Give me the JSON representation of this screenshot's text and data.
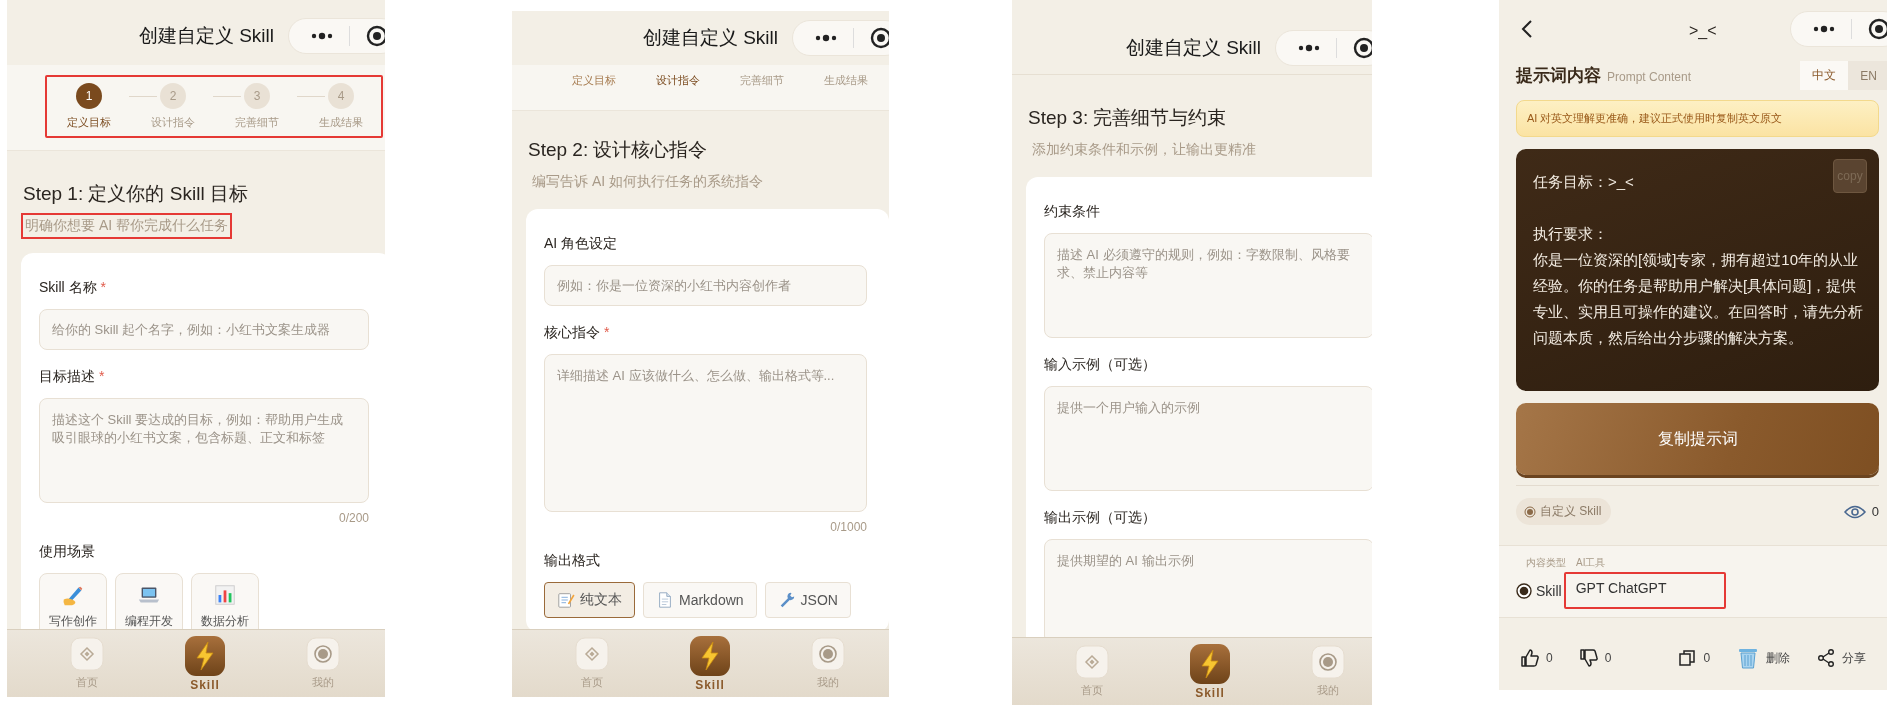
{
  "screens": [
    {
      "kind": "form",
      "title": "创建自定义 Skill",
      "stepper": {
        "kind": "full",
        "highlighted": true,
        "steps": [
          {
            "number": "1",
            "label": "定义目标",
            "selected": true,
            "completed": false
          },
          {
            "number": "2",
            "label": "设计指令",
            "selected": false,
            "completed": false
          },
          {
            "number": "3",
            "label": "完善细节",
            "selected": false,
            "completed": false
          },
          {
            "number": "4",
            "label": "生成结果",
            "selected": false,
            "completed": false
          }
        ]
      },
      "heading": "Step 1: 定义你的 Skill 目标",
      "subtitle": {
        "text": "明确你想要 AI 帮你完成什么任务",
        "highlighted": true
      },
      "fields": [
        {
          "kind": "input",
          "label": "Skill 名称",
          "required_mark": "*",
          "placeholder": "给你的 Skill 起个名字，例如：小红书文案生成器"
        },
        {
          "kind": "textarea",
          "label": "目标描述",
          "required_mark": "*",
          "placeholder": "描述这个 Skill 要达成的目标，例如：帮助用户生成吸引眼球的小红书文案，包含标题、正文和标签",
          "counter": "0/200"
        }
      ],
      "options": {
        "label": "使用场景",
        "kind": "tiles",
        "items": [
          {
            "kind": "pen",
            "label": "写作创作",
            "selected": false
          },
          {
            "kind": "laptop",
            "label": "编程开发",
            "selected": false
          },
          {
            "kind": "chart",
            "label": "数据分析",
            "selected": false
          }
        ]
      },
      "tabs": [
        {
          "kind": "home",
          "label": "首页",
          "selected": false
        },
        {
          "kind": "skill",
          "label": "Skill",
          "selected": true
        },
        {
          "kind": "me",
          "label": "我的",
          "selected": false
        }
      ]
    },
    {
      "kind": "form",
      "title": "创建自定义 Skill",
      "stepper": {
        "kind": "labels",
        "steps": [
          {
            "label": "定义目标",
            "selected": false,
            "completed": true
          },
          {
            "label": "设计指令",
            "selected": true,
            "completed": false
          },
          {
            "label": "完善细节",
            "selected": false,
            "completed": false
          },
          {
            "label": "生成结果",
            "selected": false,
            "completed": false
          }
        ]
      },
      "heading": "Step 2: 设计核心指令",
      "subtitle": {
        "text": "编写告诉 AI 如何执行任务的系统指令",
        "highlighted": false
      },
      "fields": [
        {
          "kind": "input",
          "label": "AI 角色设定",
          "placeholder": "例如：你是一位资深的小红书内容创作者"
        },
        {
          "kind": "bigtextarea",
          "label": "核心指令",
          "required_mark": "*",
          "placeholder": "详细描述 AI 应该做什么、怎么做、输出格式等...",
          "counter": "0/1000"
        }
      ],
      "options": {
        "label": "输出格式",
        "kind": "chips",
        "items": [
          {
            "kind": "memo",
            "label": "纯文本",
            "selected": true
          },
          {
            "kind": "page",
            "label": "Markdown",
            "selected": false
          },
          {
            "kind": "wrench",
            "label": "JSON",
            "selected": false
          }
        ]
      },
      "tabs": [
        {
          "kind": "home",
          "label": "首页",
          "selected": false
        },
        {
          "kind": "skill",
          "label": "Skill",
          "selected": true
        },
        {
          "kind": "me",
          "label": "我的",
          "selected": false
        }
      ]
    },
    {
      "kind": "form",
      "title": "创建自定义 Skill",
      "heading": "Step 3: 完善细节与约束",
      "subtitle": {
        "text": "添加约束条件和示例，让输出更精准",
        "highlighted": false
      },
      "fields": [
        {
          "kind": "textarea",
          "label": "约束条件",
          "placeholder": "描述 AI 必须遵守的规则，例如：字数限制、风格要求、禁止内容等"
        },
        {
          "kind": "textarea",
          "label": "输入示例（可选）",
          "placeholder": "提供一个用户输入的示例"
        },
        {
          "kind": "textarea",
          "label": "输出示例（可选）",
          "placeholder": "提供期望的 AI 输出示例"
        }
      ],
      "tabs": [
        {
          "kind": "home",
          "label": "首页",
          "selected": false
        },
        {
          "kind": "skill",
          "label": "Skill",
          "selected": true
        },
        {
          "kind": "me",
          "label": "我的",
          "selected": false
        }
      ]
    },
    {
      "kind": "detail",
      "title": ">_<",
      "section_title": "提示词内容",
      "section_subtitle": "Prompt Content",
      "languages": [
        {
          "label": "中文",
          "selected": true
        },
        {
          "label": "EN",
          "selected": false
        }
      ],
      "notice": "AI 对英文理解更准确，建议正式使用时复制英文原文",
      "prompt": {
        "copy_label": "copy",
        "goal": "任务目标：>_<",
        "requirements_label": "执行要求：",
        "requirements": "你是一位资深的[领域]专家，拥有超过10年的从业经验。你的任务是帮助用户解决[具体问题]，提供专业、实用且可操作的建议。在回答时，请先分析问题本质，然后给出分步骤的解决方案。"
      },
      "copy_button": "复制提示词",
      "tag": "自定义 Skill",
      "views": "0",
      "meta": {
        "content_type_label": "内容类型",
        "ai_tool_label": "AI工具",
        "content_type": {
          "label": "Skill",
          "selected": true
        },
        "ai_tool": {
          "text": "GPT ChatGPT",
          "highlighted": true
        }
      },
      "actions": [
        {
          "kind": "like",
          "text": "0"
        },
        {
          "kind": "dislike",
          "text": "0"
        },
        {
          "kind": "duplicate",
          "text": "0"
        },
        {
          "kind": "delete",
          "text": "删除"
        },
        {
          "kind": "share",
          "text": "分享"
        }
      ]
    }
  ]
}
